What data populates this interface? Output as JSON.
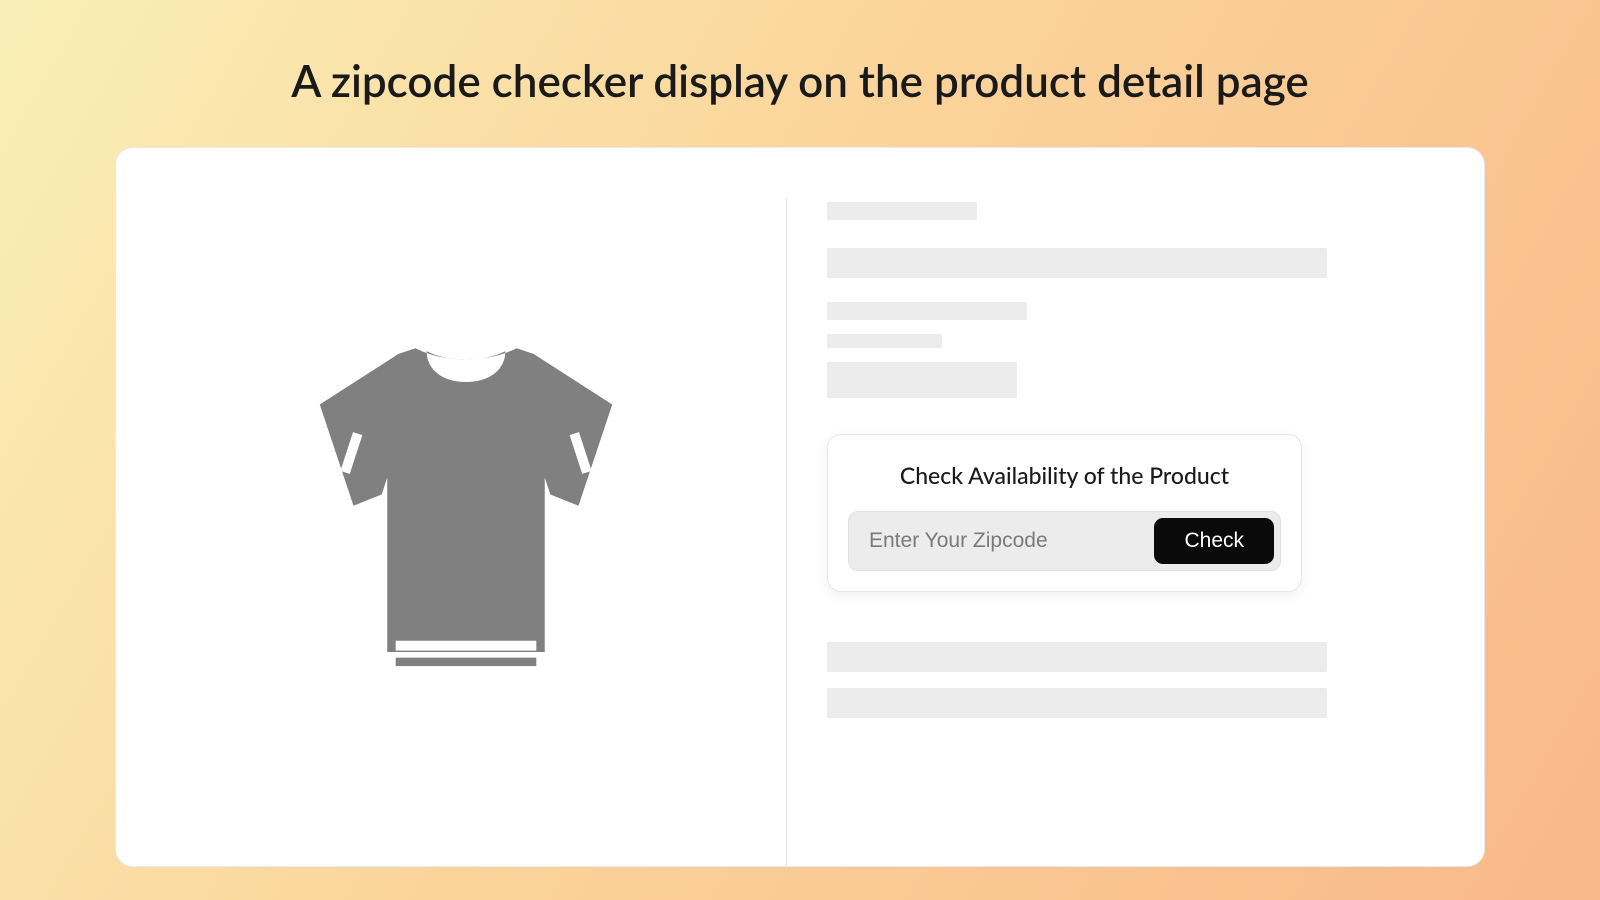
{
  "header": {
    "title": "A zipcode checker display on the product detail page"
  },
  "zipcode_checker": {
    "heading": "Check Availability of the Product",
    "input_placeholder": "Enter Your Zipcode",
    "button_label": "Check"
  }
}
